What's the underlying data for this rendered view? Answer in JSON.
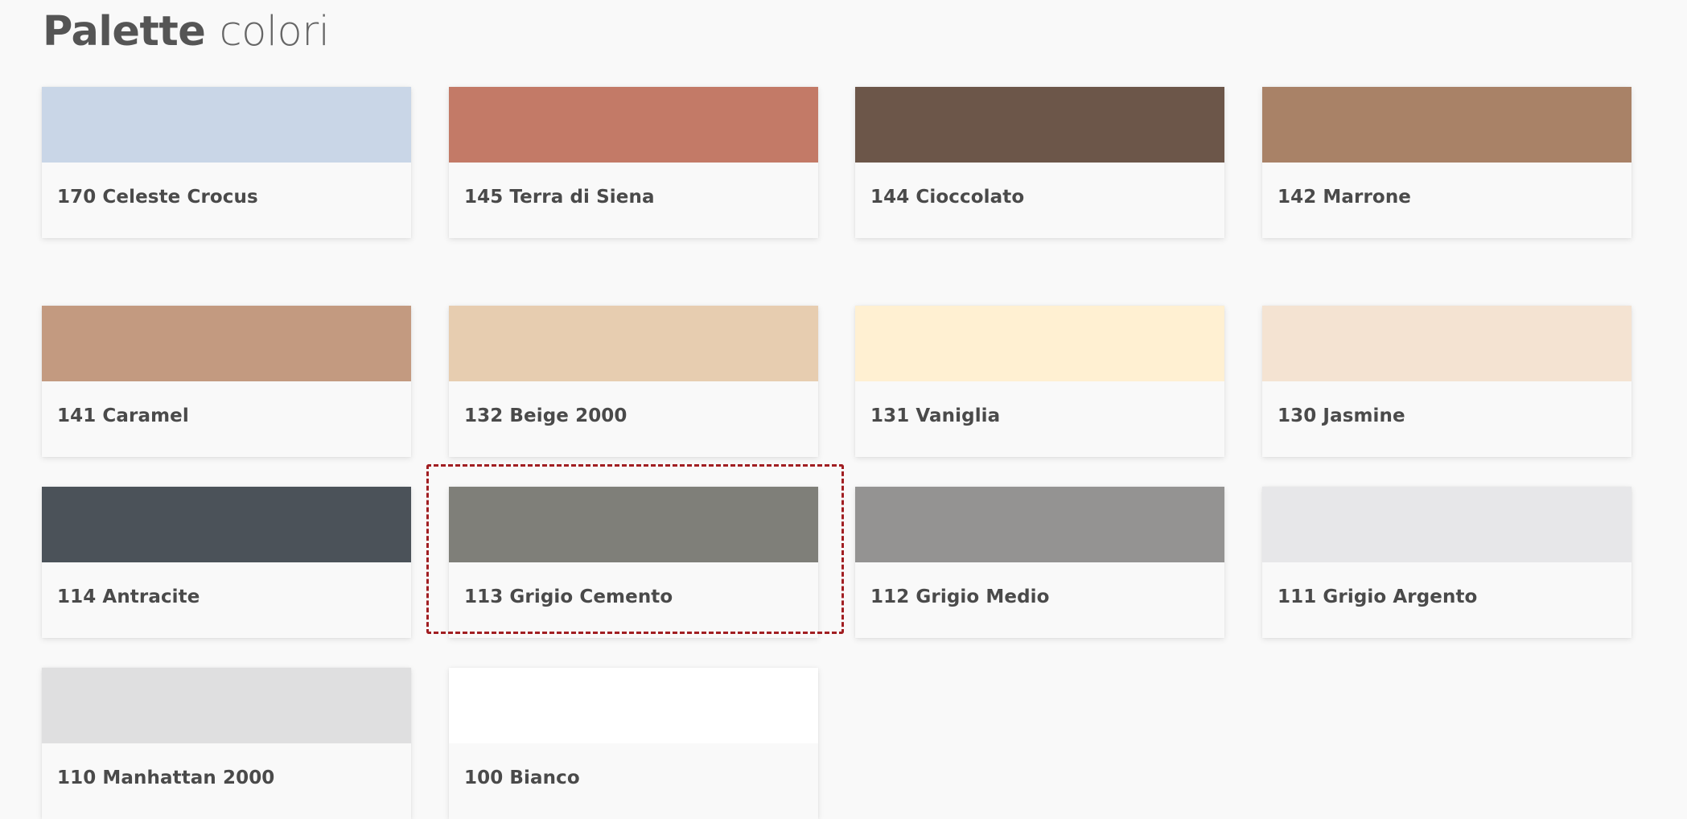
{
  "header": {
    "title_bold": "Palette",
    "title_light": "colori"
  },
  "swatches": [
    {
      "label": "170 Celeste Crocus",
      "color": "#c9d6e7"
    },
    {
      "label": "145 Terra di Siena",
      "color": "#c37a67"
    },
    {
      "label": "144 Cioccolato",
      "color": "#6c5649"
    },
    {
      "label": "142 Marrone",
      "color": "#a98267"
    },
    {
      "label": "141 Caramel",
      "color": "#c39a80"
    },
    {
      "label": "132 Beige 2000",
      "color": "#e7cdb0"
    },
    {
      "label": "131 Vaniglia",
      "color": "#fff0d2"
    },
    {
      "label": "130 Jasmine",
      "color": "#f4e3d2"
    },
    {
      "label": "114 Antracite",
      "color": "#4b5259"
    },
    {
      "label": "113 Grigio Cemento",
      "color": "#7f7f79"
    },
    {
      "label": "112 Grigio Medio",
      "color": "#949392"
    },
    {
      "label": "111 Grigio Argento",
      "color": "#e7e7e9"
    },
    {
      "label": "110 Manhattan 2000",
      "color": "#dfdfe0"
    },
    {
      "label": "100 Bianco",
      "color": "#ffffff"
    }
  ],
  "highlight": {
    "color": "#a11e22"
  }
}
